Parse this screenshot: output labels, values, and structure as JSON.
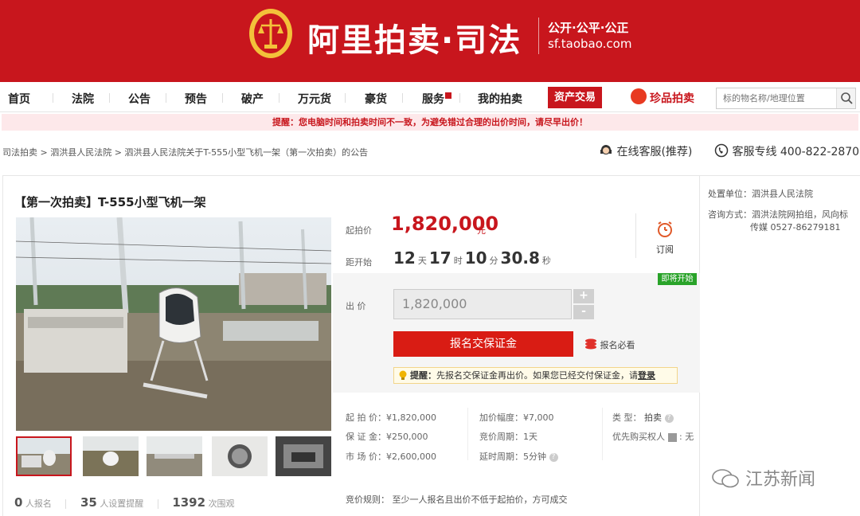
{
  "banner": {
    "brand": "阿里拍卖·司法",
    "slogan": "公开·公平·公正",
    "domain": "sf.taobao.com",
    "bg_color": "#c8161d"
  },
  "nav": {
    "items": [
      "首页",
      "法院",
      "公告",
      "预告",
      "破产",
      "万元货",
      "豪货",
      "服务",
      "我的拍卖"
    ],
    "asset_trade": "资产交易",
    "zhenpin": "珍品拍卖",
    "search_placeholder": "标的物名称/地理位置"
  },
  "warning": "提醒：您电脑时间和拍卖时间不一致，为避免错过合理的出价时间，请尽早出价！",
  "breadcrumb": "司法拍卖 > 泗洪县人民法院 > 泗洪县人民法院关于T-555小型飞机一架（第一次拍卖）的公告",
  "service": {
    "online": "在线客服(推荐)",
    "hotline": "客服专线 400-822-2870"
  },
  "item": {
    "title": "【第一次拍卖】T-555小型飞机一架",
    "start_price_label": "起拍价",
    "start_price": "1,820,000",
    "unit": "元",
    "countdown_label": "距开始",
    "days": "12",
    "day_unit": "天",
    "hours": "17",
    "hour_unit": "时",
    "minutes": "10",
    "minute_unit": "分",
    "seconds": "30.8",
    "second_unit": "秒",
    "subscribe": "订阅",
    "soon_tag": "即将开始",
    "bid_label": "出  价",
    "bid_value": "1,820,000",
    "deposit_button": "报名交保证金",
    "must_see": "报名必看",
    "tip_prefix": "提醒：",
    "tip_text": "先报名交保证金再出价。如果您已经交付保证金，请",
    "tip_login": "登录"
  },
  "details": {
    "start_price": "起 拍 价：¥1,820,000",
    "deposit": "保 证 金：¥250,000",
    "market_price": "市 场 价：¥2,600,000",
    "increment": "加价幅度：¥7,000",
    "period": "竞价周期：1天",
    "delay": "延时周期：5分钟",
    "type_label": "类    型：",
    "type_value": "拍卖",
    "priority_label": "优先购买权人",
    "priority_value": "无",
    "rule": "竞价规则：  至少一人报名且出价不低于起拍价，方可成交"
  },
  "stats": {
    "signups": "0",
    "signups_label": "人报名",
    "reminders": "35",
    "reminders_label": "人设置提醒",
    "views": "1392",
    "views_label": "次围观"
  },
  "side": {
    "court": "处置单位：泗洪县人民法院",
    "contact_label": "咨询方式：",
    "contact_1": "泗洪法院网拍组，风向标",
    "contact_2": "传媒 0527-86279181"
  },
  "watermark": "江苏新闻",
  "icons": [
    "court-emblem-icon",
    "search-icon",
    "headset-icon",
    "phone-icon",
    "alarm-clock-icon",
    "coins-icon",
    "bulb-icon",
    "help-icon",
    "wechat-icon"
  ]
}
